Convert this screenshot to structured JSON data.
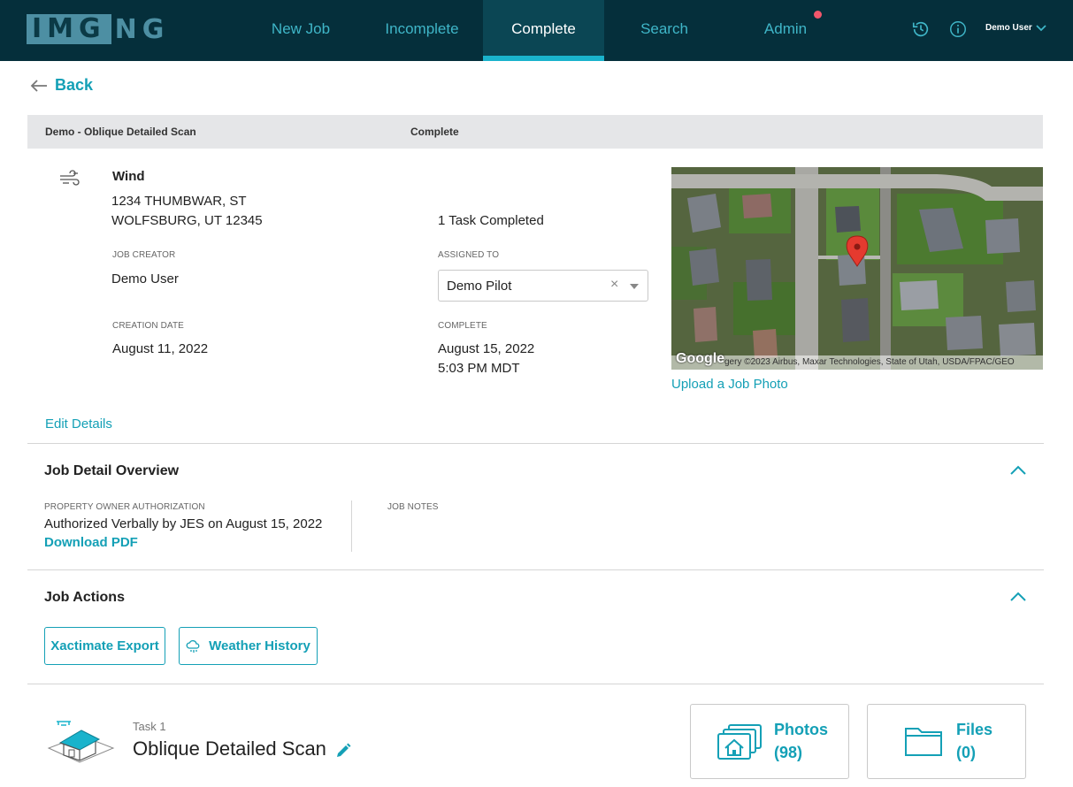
{
  "header": {
    "logo": {
      "boxed": "IMG",
      "rest": "NG"
    },
    "tabs": [
      {
        "label": "New Job"
      },
      {
        "label": "Incomplete"
      },
      {
        "label": "Complete"
      },
      {
        "label": "Search"
      },
      {
        "label": "Admin"
      }
    ],
    "active_tab": "Complete",
    "user_name": "Demo User",
    "icons": [
      "history-icon",
      "info-icon",
      "chevron-down-icon"
    ]
  },
  "nav": {
    "back_label": "Back"
  },
  "job_bar": {
    "title": "Demo - Oblique Detailed Scan",
    "status": "Complete"
  },
  "job": {
    "type": "Wind",
    "address_line1": "1234 THUMBWAR, ST",
    "address_line2": "WOLFSBURG, UT 12345",
    "tasks_completed": "1 Task Completed",
    "creator_label": "JOB CREATOR",
    "creator": "Demo User",
    "assigned_label": "ASSIGNED TO",
    "assigned": "Demo Pilot",
    "creation_label": "CREATION DATE",
    "creation_date": "August 11, 2022",
    "complete_label": "COMPLETE",
    "complete_date": "August 15, 2022",
    "complete_time": "5:03 PM MDT",
    "edit_label": "Edit Details",
    "upload_photo_label": "Upload a Job Photo"
  },
  "map": {
    "google": "Google",
    "attribution": "gery ©2023 Airbus, Maxar Technologies, State of Utah, USDA/FPAC/GEO"
  },
  "overview": {
    "title": "Job Detail Overview",
    "auth_label": "PROPERTY OWNER AUTHORIZATION",
    "auth_value": "Authorized Verbally by JES on August 15, 2022",
    "download_label": "Download PDF",
    "notes_label": "JOB NOTES"
  },
  "actions": {
    "title": "Job Actions",
    "xactimate_label": "Xactimate Export",
    "weather_label": "Weather History"
  },
  "task": {
    "number": "Task 1",
    "name": "Oblique Detailed Scan",
    "photos_label": "Photos",
    "photos_count": "(98)",
    "files_label": "Files",
    "files_count": "(0)"
  },
  "colors": {
    "accent": "#14a0b6",
    "topbar": "#052f3b",
    "active_tab": "#0b4654",
    "notify": "#f2566b"
  }
}
